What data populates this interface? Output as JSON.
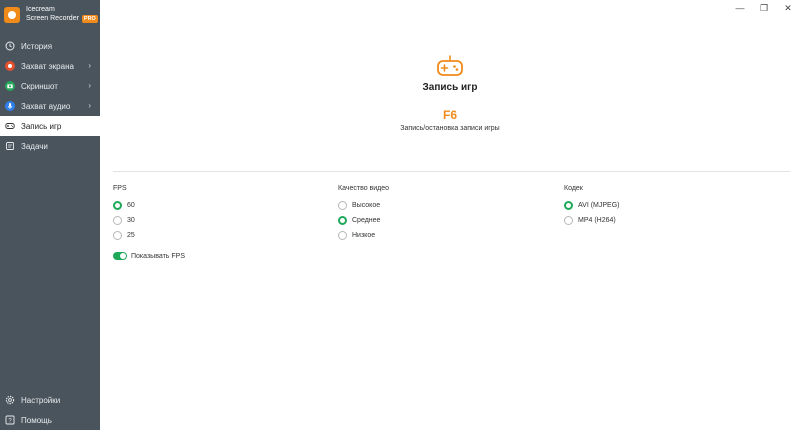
{
  "app": {
    "name_line1": "Icecream",
    "name_line2": "Screen Recorder",
    "badge": "PRO",
    "accent_color": "#f08a1a",
    "sidebar_color": "#4a545c",
    "check_color": "#1ea85a"
  },
  "window_controls": {
    "minimize": "—",
    "maximize": "❐",
    "close": "✕"
  },
  "sidebar": {
    "items": [
      {
        "label": "История",
        "icon": "clock-icon",
        "has_chevron": false,
        "active": false
      },
      {
        "label": "Захват экрана",
        "icon": "record-icon",
        "has_chevron": true,
        "active": false
      },
      {
        "label": "Скриншот",
        "icon": "camera-icon",
        "has_chevron": true,
        "active": false
      },
      {
        "label": "Захват аудио",
        "icon": "microphone-icon",
        "has_chevron": true,
        "active": false
      },
      {
        "label": "Запись игр",
        "icon": "gamepad-icon",
        "has_chevron": false,
        "active": true
      },
      {
        "label": "Задачи",
        "icon": "tasks-icon",
        "has_chevron": false,
        "active": false
      }
    ],
    "bottom": [
      {
        "label": "Настройки",
        "icon": "gear-icon"
      },
      {
        "label": "Помощь",
        "icon": "help-icon"
      }
    ],
    "chevron": "›"
  },
  "main": {
    "title": "Запись игр",
    "hotkey": "F6",
    "hotkey_desc": "Запись/остановка записи игры",
    "fps": {
      "title": "FPS",
      "options": [
        "60",
        "30",
        "25"
      ],
      "selected": 0
    },
    "quality": {
      "title": "Качество видео",
      "options": [
        "Высокое",
        "Среднее",
        "Низкое"
      ],
      "selected": 1
    },
    "codec": {
      "title": "Кодек",
      "options": [
        "AVI (MJPEG)",
        "MP4 (H264)"
      ],
      "selected": 0
    },
    "show_fps": {
      "label": "Показывать FPS",
      "enabled": true
    }
  }
}
